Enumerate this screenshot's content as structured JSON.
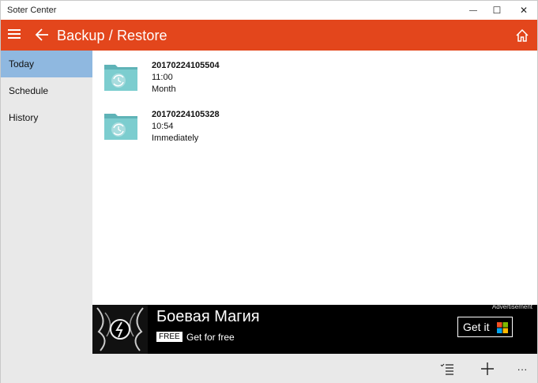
{
  "window": {
    "title": "Soter Center",
    "minimize_glyph": "—",
    "maximize_glyph": "☐",
    "close_glyph": "✕"
  },
  "header": {
    "title": "Backup / Restore",
    "color": "#e3461c"
  },
  "sidebar": {
    "items": [
      {
        "label": "Today",
        "active": true
      },
      {
        "label": "Schedule",
        "active": false
      },
      {
        "label": "History",
        "active": false
      }
    ],
    "active_color": "#8fb8e0"
  },
  "backups": [
    {
      "name": "20170224105504",
      "time": "11:00",
      "frequency": "Month",
      "icon": "backup-folder-icon"
    },
    {
      "name": "20170224105328",
      "time": "10:54",
      "frequency": "Immediately",
      "icon": "backup-folder-icon"
    }
  ],
  "ad": {
    "title": "Боевая Магия",
    "badge": "FREE",
    "subtitle": "Get for free",
    "label": "Advertisement",
    "button": "Get it"
  },
  "commands": {
    "more_glyph": "···"
  }
}
